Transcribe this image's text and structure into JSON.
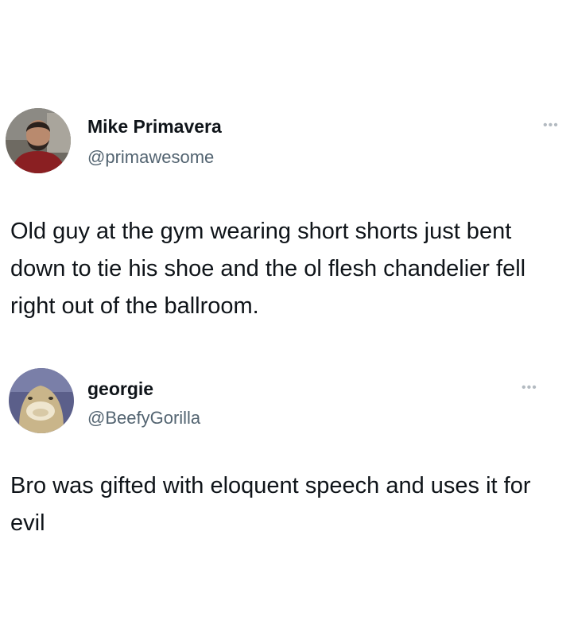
{
  "tweets": [
    {
      "display_name": "Mike Primavera",
      "handle": "@primawesome",
      "more_icon": "more-horizontal-icon",
      "text": "Old guy at the gym wearing short shorts just bent down to tie his shoe and the ol flesh chandelier fell right out of the ballroom."
    },
    {
      "display_name": "georgie",
      "handle": "@BeefyGorilla",
      "more_icon": "more-horizontal-icon",
      "text": "Bro was gifted with eloquent speech and uses it for evil"
    }
  ],
  "colors": {
    "text_primary": "#0f1419",
    "text_secondary": "#536471",
    "icon_muted": "#b3bac1",
    "background": "#ffffff"
  }
}
